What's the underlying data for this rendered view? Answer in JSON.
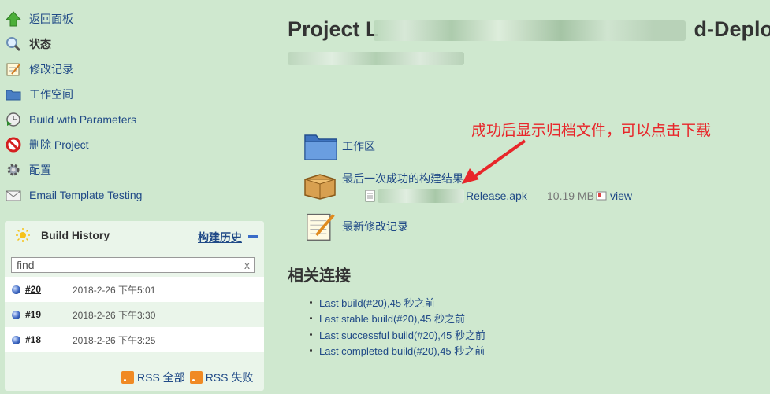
{
  "sidebar": {
    "tasks": [
      {
        "label": "返回面板",
        "icon": "up-arrow-icon"
      },
      {
        "label": "状态",
        "icon": "magnifier-icon"
      },
      {
        "label": "修改记录",
        "icon": "notepad-icon"
      },
      {
        "label": "工作空间",
        "icon": "folder-icon"
      },
      {
        "label": "Build with Parameters",
        "icon": "clock-play-icon"
      },
      {
        "label": "删除 Project",
        "icon": "no-entry-icon"
      },
      {
        "label": "配置",
        "icon": "gear-icon"
      },
      {
        "label": "Email Template Testing",
        "icon": "envelope-icon"
      }
    ]
  },
  "build_history": {
    "title": "Build History",
    "trend": "构建历史",
    "find_value": "find",
    "clear": "x",
    "builds": [
      {
        "number": "#20",
        "date": "2018-2-26 下午5:01"
      },
      {
        "number": "#19",
        "date": "2018-2-26 下午3:30"
      },
      {
        "number": "#18",
        "date": "2018-2-26 下午3:25"
      }
    ],
    "rss_all": "RSS 全部",
    "rss_failed": "RSS 失败"
  },
  "main": {
    "title_prefix": "Project L",
    "title_suffix": "d-Deploy",
    "workspace_link": "工作区",
    "last_success_link": "最后一次成功的构建结果",
    "artifact_prefix": "",
    "artifact_suffix": "Release.apk",
    "artifact_size": "10.19 MB",
    "view_link": "view",
    "changes_link": "最新修改记录",
    "annotation": "成功后显示归档文件，可以点击下载",
    "related_heading": "相关连接",
    "related_links": [
      "Last build(#20),45 秒之前",
      "Last stable build(#20),45 秒之前",
      "Last successful build(#20),45 秒之前",
      "Last completed build(#20),45 秒之前"
    ]
  },
  "colors": {
    "background": "#cfe8cf",
    "link": "#204a87",
    "annotation": "#e8262a"
  }
}
